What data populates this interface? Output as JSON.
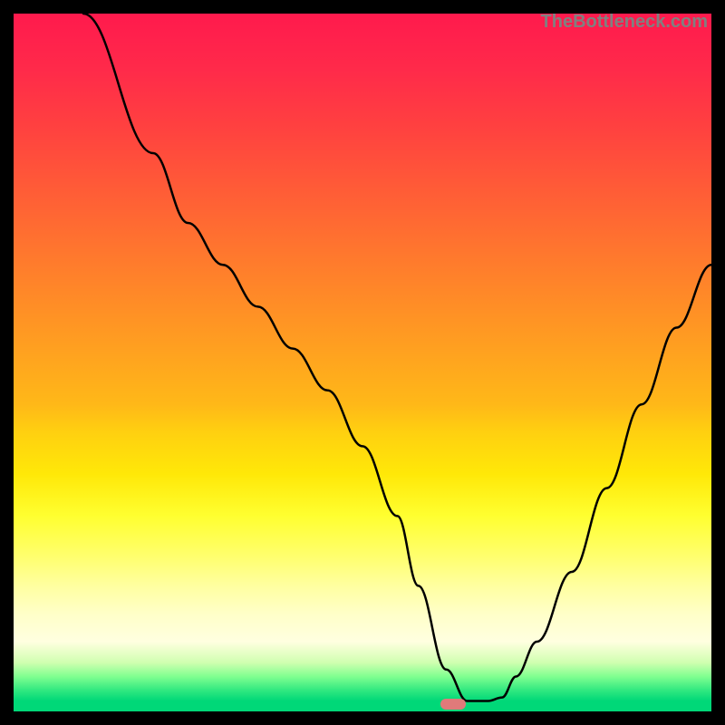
{
  "watermark": "TheBottleneck.com",
  "chart_data": {
    "type": "line",
    "title": "",
    "xlabel": "",
    "ylabel": "",
    "xlim": [
      0,
      100
    ],
    "ylim": [
      0,
      100
    ],
    "x": [
      10,
      20,
      25,
      30,
      35,
      40,
      45,
      50,
      55,
      58,
      62,
      65,
      68,
      70,
      72,
      75,
      80,
      85,
      90,
      95,
      100
    ],
    "y": [
      100,
      80,
      70,
      64,
      58,
      52,
      46,
      38,
      28,
      18,
      6,
      1.5,
      1.5,
      2,
      5,
      10,
      20,
      32,
      44,
      55,
      64
    ],
    "marker_position": {
      "x": 63,
      "y": 1.0
    },
    "colors": {
      "gradient_top": "#ff1a4d",
      "gradient_mid": "#ffe808",
      "gradient_bottom": "#00d878",
      "curve": "#000000",
      "marker": "#e07a7a"
    }
  }
}
